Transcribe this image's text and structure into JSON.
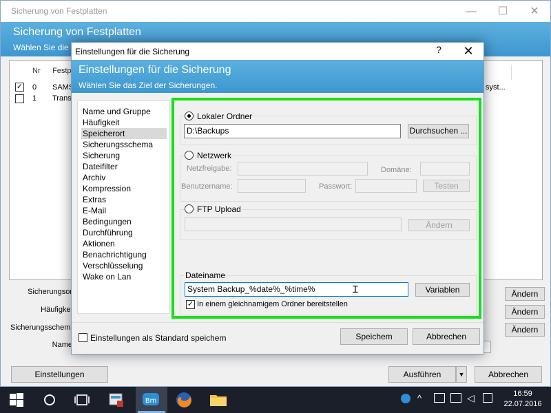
{
  "main": {
    "title": "Sicherung von Festplatten",
    "window_controls": [
      "—",
      "☐",
      "✕"
    ],
    "header_title": "Sicherung von Festplatten",
    "header_sub": "Wählen Sie die",
    "list": {
      "col_nr": "Nr",
      "col_fest": "Festp",
      "rows": [
        {
          "checked": true,
          "nr": "0",
          "name": "SAMS"
        },
        {
          "checked": false,
          "nr": "1",
          "name": "Trans"
        }
      ],
      "trailing_text": "syst..."
    },
    "labels": {
      "sicherungsort": "Sicherungsor",
      "haeufigkeit": "Häufigkei",
      "sicherungsschema": "Sicherungsschema",
      "name": "Name"
    },
    "aendern_label": "Ändern",
    "buttons": {
      "einstellungen": "Einstellungen",
      "ausfuehren": "Ausführen",
      "abbrechen": "Abbrechen"
    }
  },
  "dialog": {
    "title": "Einstellungen für die Sicherung",
    "help": "?",
    "close": "✕",
    "header_title": "Einstellungen für die Sicherung",
    "header_sub": "Wählen Sie das Ziel der Sicherungen.",
    "nav": [
      "Name und Gruppe",
      "Häufigkeit",
      "Speicherort",
      "Sicherungsschema",
      "Sicherung",
      "Dateifilter",
      "Archiv",
      "Kompression",
      "Extras",
      "E-Mail",
      "Bedingungen",
      "Durchführung",
      "Aktionen",
      "Benachrichtigung",
      "Verschlüsselung",
      "Wake on Lan"
    ],
    "selected_nav": "Speicherort",
    "local": {
      "label": "Lokaler Ordner",
      "selected": true,
      "path": "D:\\Backups",
      "browse": "Durchsuchen ..."
    },
    "network": {
      "label": "Netzwerk",
      "share_label": "Netzfreigabe:",
      "domain_label": "Domäne:",
      "user_label": "Benutzername:",
      "password_label": "Passwort:",
      "test": "Testen"
    },
    "ftp": {
      "label": "FTP Upload",
      "change": "Ändern"
    },
    "filename": {
      "label": "Dateiname",
      "value": "System Backup_%date%_%time%",
      "variables": "Variablen",
      "same_folder_label": "In einem gleichnamigem Ordner bereitstellen",
      "same_folder_checked": true
    },
    "default_label": "Einstellungen als Standard speichem",
    "save": "Speichem",
    "cancel": "Abbrechen"
  },
  "taskbar": {
    "time": "16:59",
    "date": "22.07.2016"
  }
}
